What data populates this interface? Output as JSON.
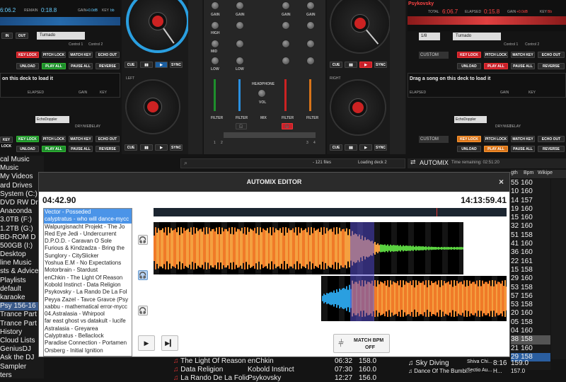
{
  "deckA": {
    "time": "6:06.2",
    "remain": "REMAIN",
    "remain_time": "0:18.8",
    "key": "KEY",
    "key_val": "bb",
    "gain": "GAIN",
    "gain_val": "+0.0dB",
    "bpm_lbl": "BPM",
    "master": "MASTER",
    "effect": "Turnado",
    "control1": "Control 1",
    "control2": "Control 2",
    "in": "IN",
    "out": "OUT",
    "loop_btn": "LOOP",
    "pct": "200%"
  },
  "deckB": {
    "title": "Psykovsky",
    "total": "TOTAL",
    "total_val": "6:06.7",
    "elapsed": "ELAPSED",
    "remain_val": "0:15.8",
    "gain": "GAIN",
    "gain_val": "+0.0dB",
    "key": "KEY",
    "key_val": "Bb",
    "bpm_lbl": "BPM",
    "master": "MASTER",
    "loop_val": "1/8",
    "effect": "Turnado",
    "control1": "Control 1",
    "control2": "Control 2",
    "pct": "200%"
  },
  "rowbtns": {
    "key_lock": "KEY LOCK",
    "pitch_lock": "PITCH LOCK",
    "match_key": "MATCH KEY",
    "echo_out": "ECHO OUT",
    "unload": "UNLOAD",
    "play_all": "PLAY ALL",
    "pause_all": "PAUSE ALL",
    "reverse": "REVERSE",
    "custom": "CUSTOM",
    "pad": "PAD"
  },
  "deckC": {
    "msg": "on this deck to load it",
    "elapsed": "ELAPSED",
    "gain": "GAIN",
    "key": "KEY",
    "bpm_lbl": "BPM",
    "master": "MASTER",
    "tap": "TAP",
    "effect": "EchoDoppler",
    "drywet": "DRY/WET",
    "delay": "DELAY",
    "left": "LEFT",
    "num": "4",
    "num2": "4"
  },
  "deckD": {
    "msg": "Drag a song on this deck to load it",
    "elapsed": "ELAPSED",
    "gain": "GAIN",
    "key": "KEY",
    "bpm_lbl": "BPM",
    "master": "MASTER",
    "tap": "TAP",
    "effect": "EchoDoppler",
    "drywet": "DRY/WET",
    "delay": "DELAY",
    "right": "RIGHT",
    "num": "4"
  },
  "mixer": {
    "gain": "GAIN",
    "high": "HIGH",
    "mid": "MID",
    "low": "LOW",
    "filter": "FILTER",
    "headphone": "HEADPHONE",
    "vol": "VOL",
    "mix": "MIX"
  },
  "transport": {
    "cue": "CUE",
    "sync": "SYNC",
    "ch1": "1",
    "ch2": "2",
    "ch3": "3",
    "ch4": "4"
  },
  "browser": {
    "items": [
      "cal Music",
      "Music",
      "My Videos",
      "ard Drives",
      "System (C:)",
      "DVD RW Dr",
      "Anaconda",
      "3.0TB (F:)",
      "1.2TB (G:)",
      "BD-ROM D",
      "500GB (I:)",
      "Desktop",
      "line Music",
      "sts & Advice",
      "Playlists",
      "default",
      "karaoke",
      "Psy 156-16",
      "Trance Part",
      "Trance Part",
      "History",
      "Cloud Lists",
      "GeniusDJ",
      "Ask the DJ",
      "Sampler",
      "ters"
    ],
    "selected_index": 17
  },
  "search": {
    "count": "- 121 files",
    "loading": "Loading deck 2"
  },
  "automix_bar": {
    "label": "AUTOMIX",
    "remaining": "Time remaining: 02:51:20"
  },
  "cols": {
    "length": "gth",
    "bpm": "Bpm",
    "wiki": "Wikipe"
  },
  "bpm_rows": [
    {
      "len": "55",
      "bpm": "160"
    },
    {
      "len": "10",
      "bpm": "160"
    },
    {
      "len": "14",
      "bpm": "157"
    },
    {
      "len": "19",
      "bpm": "160"
    },
    {
      "len": "15",
      "bpm": "160"
    },
    {
      "len": "32",
      "bpm": "160"
    },
    {
      "len": "51",
      "bpm": "158"
    },
    {
      "len": "41",
      "bpm": "160"
    },
    {
      "len": "36",
      "bpm": "160"
    },
    {
      "len": "22",
      "bpm": "161"
    },
    {
      "len": "15",
      "bpm": "158"
    },
    {
      "len": "29",
      "bpm": "160"
    },
    {
      "len": "53",
      "bpm": "158"
    },
    {
      "len": "57",
      "bpm": "156"
    },
    {
      "len": "53",
      "bpm": "158"
    },
    {
      "len": "20",
      "bpm": "160"
    },
    {
      "len": "05",
      "bpm": "158"
    },
    {
      "len": "04",
      "bpm": "160"
    },
    {
      "len": "38",
      "bpm": "158"
    },
    {
      "len": "21",
      "bpm": "160"
    },
    {
      "len": "29",
      "bpm": "158"
    }
  ],
  "tracks_bottom": [
    {
      "title": "The Light Of Reason",
      "artist": "enChkin",
      "time": "06:32",
      "bpm": "158.0"
    },
    {
      "title": "Data Religion",
      "artist": "Kobold Instinct",
      "time": "07:30",
      "bpm": "160.0"
    },
    {
      "title": "La Rando De La Folio",
      "artist": "Psykovsky",
      "time": "12:27",
      "bpm": "156.0"
    }
  ],
  "sidelist": [
    {
      "title": "Sky Diving",
      "artist": "Shiva Chi...",
      "time": "8:16",
      "bpm": "159.0"
    },
    {
      "title": "Dance Of The Bumbl...",
      "artist": "Sectio Au...",
      "time": "H...",
      "bpm": "157.0"
    }
  ],
  "automix_editor": {
    "title": "AUTOMIX EDITOR",
    "close": "×",
    "left_time": "04:42.90",
    "right_time": "14:13:59.41",
    "playlist": [
      "Vector - Posseded",
      "calyptratus - who will dance-mycc",
      "Walpurgisnacht Projekt - The Jo",
      "Red Eye Jedi - Undercurrent",
      "D.P.O.D. - Caravan O Sole",
      "Furious & Kindzadza - Bring the",
      "Sunglory - CitySlicker",
      "Yoshua E.M - No Expectations",
      "Motorbrain - Stardust",
      "enChkin - The Light Of Reason",
      "Kobold Instinct - Data Religion",
      "Psykovsky - La Rando De La Fol",
      "Peyya Zazel - Tavce Gravce (Psy",
      "xabbu - mathematical error-mycc",
      "04.Astralasia - Whirpool",
      "far east ghost vs datakult - lucife",
      "Astralasia - Greyarea",
      "Calyptratus - Bellaclock",
      "Paradise Connection - Portamen",
      "Orsberg - Initial Ignition"
    ],
    "selected": [
      0,
      1
    ],
    "match_bpm": "MATCH BPM",
    "match_state": "OFF",
    "play_icon": "play-icon",
    "next_icon": "next-track-icon"
  }
}
